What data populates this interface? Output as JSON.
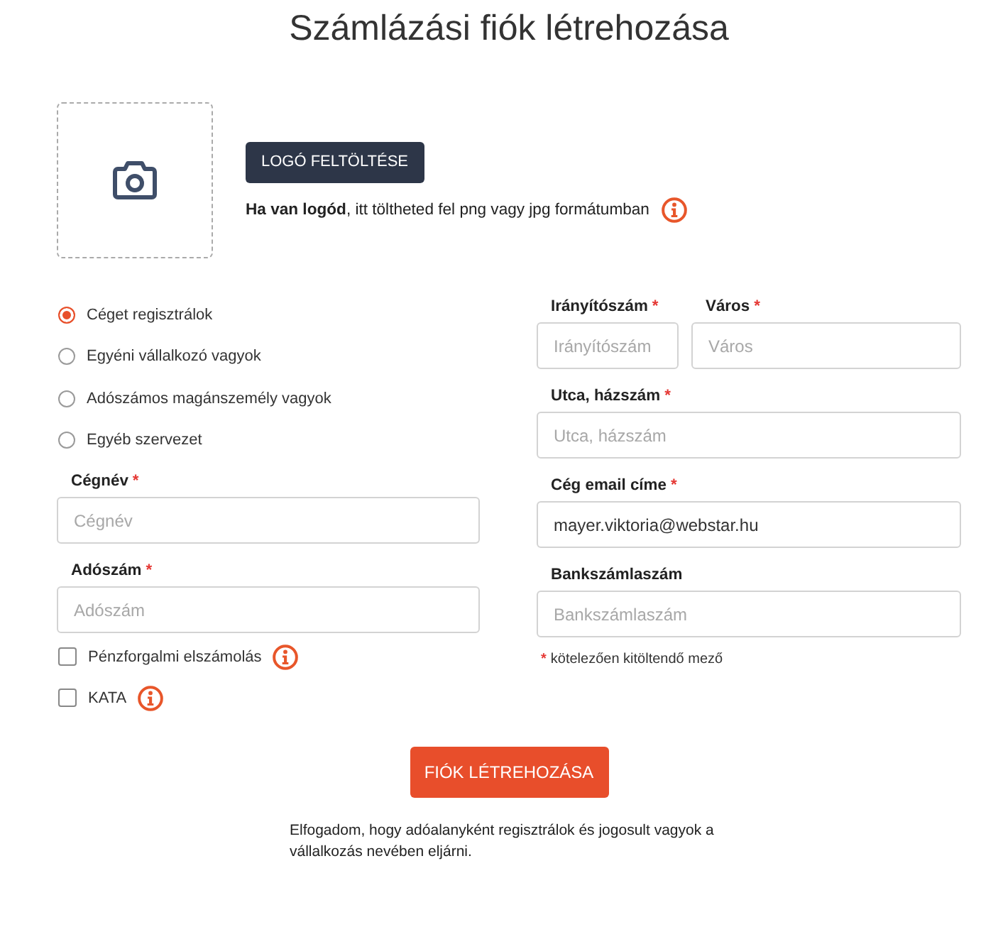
{
  "title": "Számlázási fiók létrehozása",
  "logo_upload": {
    "button": "LOGÓ FELTÖLTÉSE",
    "hint": "**Ha van logód**, itt töltheted fel png vagy jpg formátumban",
    "info_icon": true
  },
  "entity_types": [
    {
      "label": "Céget regisztrálok",
      "selected": true
    },
    {
      "label": "Egyéni vállalkozó vagyok",
      "selected": false
    },
    {
      "label": "Adószámos magánszemély vagyok",
      "selected": false
    },
    {
      "label": "Egyéb szervezet",
      "selected": false
    }
  ],
  "company_fields": [
    {
      "label": "Cégnév",
      "required_mark": "*",
      "placeholder": "Cégnév"
    },
    {
      "label": "Adószám",
      "required_mark": "*",
      "placeholder": "Adószám"
    }
  ],
  "options": [
    {
      "label": "Pénzforgalmi elszámolás",
      "checked": false,
      "info_icon": true
    },
    {
      "label": "KATA",
      "checked": false,
      "info_icon": true
    }
  ],
  "address_rows": [
    {
      "fields": [
        {
          "label": "Irányítószám",
          "required_mark": "*",
          "placeholder": "Irányítószám"
        },
        {
          "label": "Város",
          "required_mark": "*",
          "placeholder": "Város"
        }
      ]
    },
    {
      "fields": [
        {
          "label": "Utca, házszám",
          "required_mark": "*",
          "placeholder": "Utca, házszám"
        }
      ]
    },
    {
      "fields": [
        {
          "label": "Cég email címe",
          "required_mark": "*",
          "value": "mayer.viktoria@webstar.hu"
        }
      ]
    },
    {
      "fields": [
        {
          "label": "Bankszámlaszám",
          "placeholder": "Bankszámlaszám"
        }
      ]
    }
  ],
  "required_note": {
    "mark": "*",
    "text": "kötelezően kitöltendő mező"
  },
  "submit_button": "FIÓK LÉTREHOZÁSA",
  "terms": "Elfogadom, hogy adóalanyként regisztrálok és jogosult vagyok a vállalkozás nevében eljárni."
}
